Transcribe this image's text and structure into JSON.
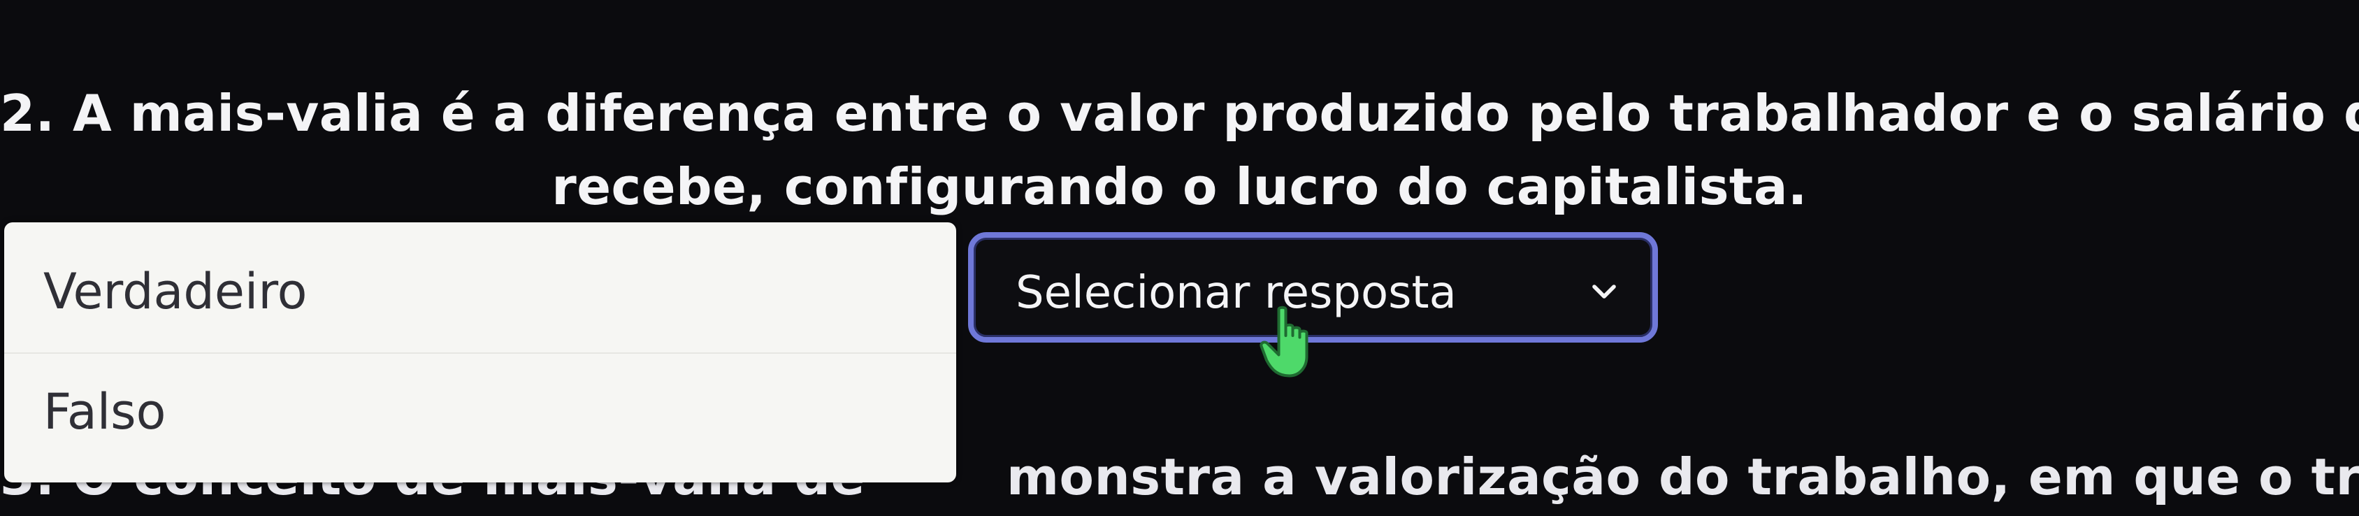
{
  "question2": {
    "line1": "2. A mais-valia é a diferença entre o valor produzido pelo trabalhador e o salário que e",
    "line2": "recebe, configurando o lucro do capitalista."
  },
  "dropdown": {
    "options": [
      {
        "label": "Verdadeiro"
      },
      {
        "label": "Falso"
      }
    ],
    "select_label": "Selecionar resposta",
    "chevron_icon": "chevron-down-icon",
    "accent_color": "#6f78d8"
  },
  "question3": {
    "hidden_part": "3. O conceito de mais-valia de",
    "visible_part": "monstra a valorização do trabalho, em que o trabalhado"
  },
  "cursor": {
    "icon": "hand-pointer-icon",
    "color": "#4ed96a"
  }
}
